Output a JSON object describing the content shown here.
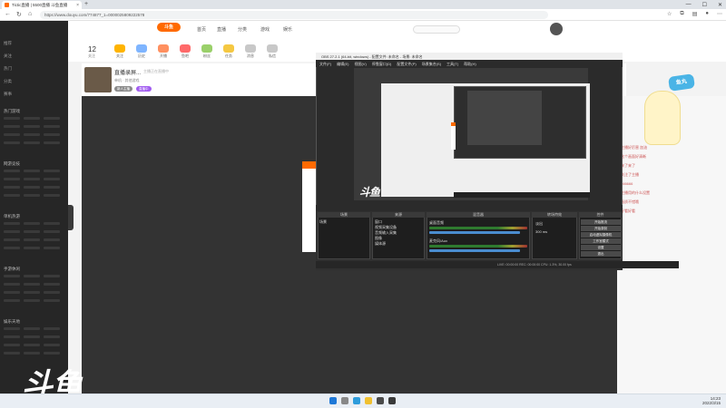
{
  "browser": {
    "tab_title": "Tictic直播 | 5500直播 斗鱼直播",
    "new_tab": "+",
    "url": "https://www.douyu.com/774877_1=0000025809222578",
    "controls": {
      "minimize": "—",
      "maximize": "☐",
      "close": "✕"
    }
  },
  "douyu": {
    "logo": "斗鱼",
    "follow_count": "12",
    "follow_label": "关注",
    "top_links": [
      "首页",
      "直播",
      "分类",
      "游戏",
      "娱乐"
    ],
    "categories": [
      {
        "label": "关注",
        "color": "#ffb400"
      },
      {
        "label": "历史",
        "color": "#7fb5ff"
      },
      {
        "label": "开播",
        "color": "#ff9060"
      },
      {
        "label": "鱼吧",
        "color": "#ff6a6a"
      },
      {
        "label": "粉丝",
        "color": "#9ad06a"
      },
      {
        "label": "任务",
        "color": "#f5c842"
      },
      {
        "label": "消息",
        "color": "#c8c8c8"
      },
      {
        "label": "私信",
        "color": "#c8c8c8"
      }
    ],
    "room": {
      "title": "直播录屏...",
      "subtitle": "主播正在直播中",
      "meta": "单机 · 其他游戏",
      "tags": [
        "新人主播",
        "直播中"
      ]
    },
    "watermark": "斗鱼",
    "sidebar": {
      "top_items": [
        "推荐",
        "关注",
        "热门",
        "分类",
        "赛事"
      ],
      "group_titles": [
        "热门游戏",
        "网游竞技",
        "单机热游",
        "手游休闲",
        "娱乐天地"
      ]
    },
    "chat_lines": [
      "主播好厉害 加油",
      "这个画面好清晰",
      "来了来了",
      "关注了主播",
      "666666",
      "主播用的什么设置",
      "画质不错哦",
      "好看好看"
    ],
    "mascot_badge": "鱼丸"
  },
  "obs": {
    "title": "OBS 27.2.1 (64-bit, windows) - 配置文件: 未命名 - 场景: 未命名",
    "menu": [
      "文件(F)",
      "编辑(E)",
      "视图(V)",
      "停靠窗口(D)",
      "配置文件(P)",
      "场景集合(S)",
      "工具(T)",
      "帮助(H)"
    ],
    "docks": {
      "scenes": "场景",
      "sources": "来源",
      "mixer": "混音器",
      "transitions": "转场特效",
      "controls": "控件"
    },
    "scene_name": "场景",
    "sources": [
      "窗口",
      "视频采集设备",
      "音频输入采集",
      "图像",
      "媒体源"
    ],
    "mixer_channels": [
      "桌面音频",
      "麦克风/Aux"
    ],
    "transition": "淡出",
    "duration": "300 ms",
    "controls": [
      "开始推流",
      "开始录制",
      "启动虚拟摄像机",
      "工作室模式",
      "设置",
      "退出"
    ],
    "status": "LIVE: 00:00:00   REC: 00:00:00   CPU: 1.3%, 30.00 fps"
  },
  "taskbar": {
    "time": "14:23",
    "date": "2022/3/15"
  },
  "colors": {
    "douyu_orange": "#ff6a00",
    "obs_bg": "#2b2b2b",
    "sidebar_bg": "#262626"
  }
}
